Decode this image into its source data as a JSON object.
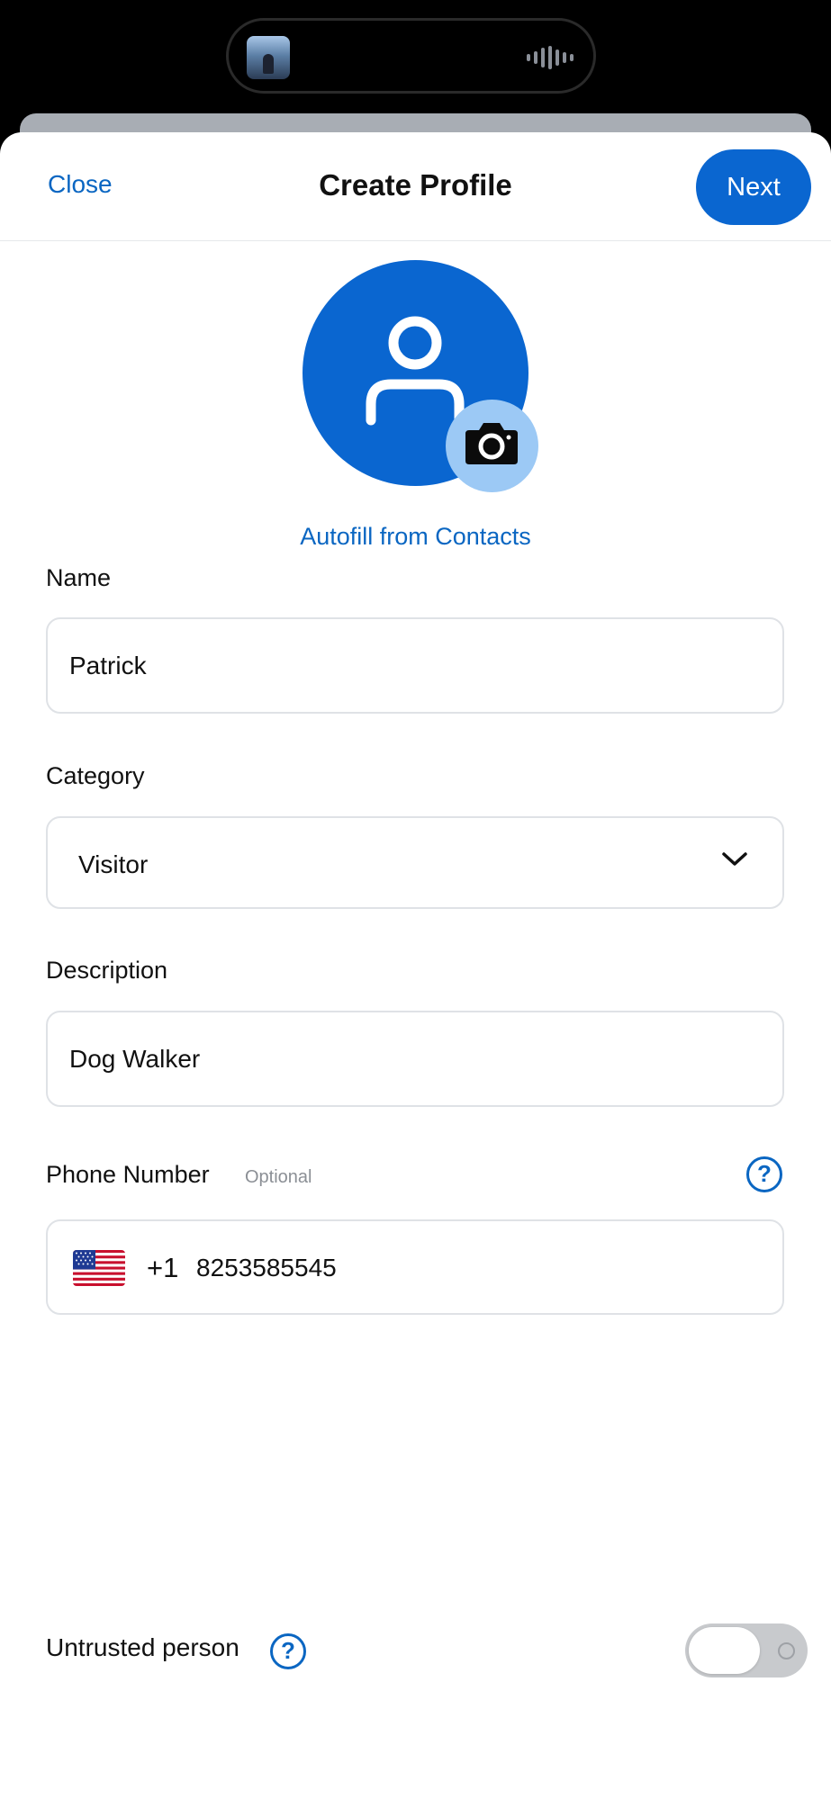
{
  "header": {
    "close_label": "Close",
    "title": "Create Profile",
    "next_label": "Next"
  },
  "avatar": {
    "icon": "person-icon",
    "camera_icon": "camera-icon",
    "autofill_label": "Autofill from Contacts"
  },
  "name": {
    "label": "Name",
    "value": "Patrick"
  },
  "category": {
    "label": "Category",
    "value": "Visitor"
  },
  "description": {
    "label": "Description",
    "value": "Dog Walker"
  },
  "phone": {
    "label": "Phone Number",
    "optional_label": "Optional",
    "help_symbol": "?",
    "country_code": "+1",
    "value": "8253585545",
    "flag": "us-flag-icon"
  },
  "untrusted": {
    "label": "Untrusted person",
    "help_symbol": "?",
    "enabled": false
  },
  "colors": {
    "accent": "#0a66d0",
    "link": "#0a66c2",
    "avatar_badge": "#9cc9f5",
    "border": "#dfe2e6"
  }
}
